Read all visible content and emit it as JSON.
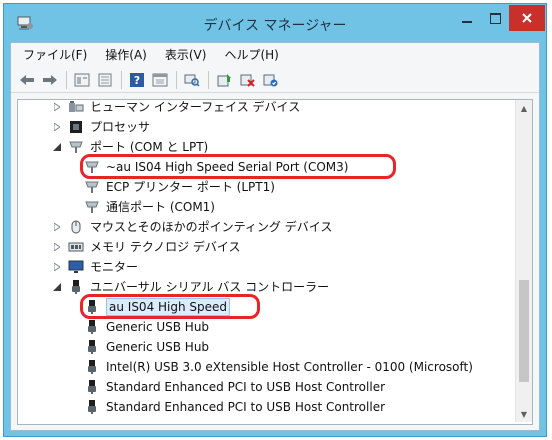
{
  "window": {
    "title": "デバイス マネージャー"
  },
  "colors": {
    "titlebar": "#71c3e6",
    "close": "#c9302c",
    "highlight_ring": "#e8232a",
    "selection": "#dcebfc"
  },
  "menu": [
    {
      "label": "ファイル(F)"
    },
    {
      "label": "操作(A)"
    },
    {
      "label": "表示(V)"
    },
    {
      "label": "ヘルプ(H)"
    }
  ],
  "toolbar": {
    "icons": [
      "back-icon",
      "forward-icon",
      "properties-view-icon",
      "device-list-icon",
      "help-icon",
      "action-view-icon",
      "scan-hardware-icon",
      "update-driver-icon",
      "uninstall-icon",
      "enable-device-icon"
    ]
  },
  "tree": {
    "items": [
      {
        "label": "ヒューマン インターフェイス デバイス",
        "state": "collapsed",
        "icon": "hid-icon"
      },
      {
        "label": "プロセッサ",
        "state": "collapsed",
        "icon": "processor-icon"
      },
      {
        "label": "ポート (COM と LPT)",
        "state": "expanded",
        "icon": "port-icon"
      },
      {
        "label": "~au IS04 High Speed Serial Port  (COM3)",
        "state": "leaf",
        "icon": "port-icon",
        "highlighted": true
      },
      {
        "label": "ECP プリンター ポート (LPT1)",
        "state": "leaf",
        "icon": "port-icon"
      },
      {
        "label": "通信ポート (COM1)",
        "state": "leaf",
        "icon": "port-icon"
      },
      {
        "label": "マウスとそのほかのポインティング デバイス",
        "state": "collapsed",
        "icon": "mouse-icon"
      },
      {
        "label": "メモリ テクノロジ デバイス",
        "state": "collapsed",
        "icon": "memory-icon"
      },
      {
        "label": "モニター",
        "state": "collapsed",
        "icon": "monitor-icon"
      },
      {
        "label": "ユニバーサル シリアル バス コントローラー",
        "state": "expanded",
        "icon": "usb-icon"
      },
      {
        "label": "au IS04 High Speed",
        "state": "leaf",
        "icon": "usb-icon",
        "highlighted": true,
        "selected": true
      },
      {
        "label": "Generic USB Hub",
        "state": "leaf",
        "icon": "usb-icon"
      },
      {
        "label": "Generic USB Hub",
        "state": "leaf",
        "icon": "usb-icon"
      },
      {
        "label": "Intel(R) USB 3.0 eXtensible Host Controller - 0100 (Microsoft)",
        "state": "leaf",
        "icon": "usb-icon"
      },
      {
        "label": "Standard Enhanced PCI to USB Host Controller",
        "state": "leaf",
        "icon": "usb-icon"
      },
      {
        "label": "Standard Enhanced PCI to USB Host Controller",
        "state": "leaf",
        "icon": "usb-icon",
        "partial": true
      }
    ]
  }
}
